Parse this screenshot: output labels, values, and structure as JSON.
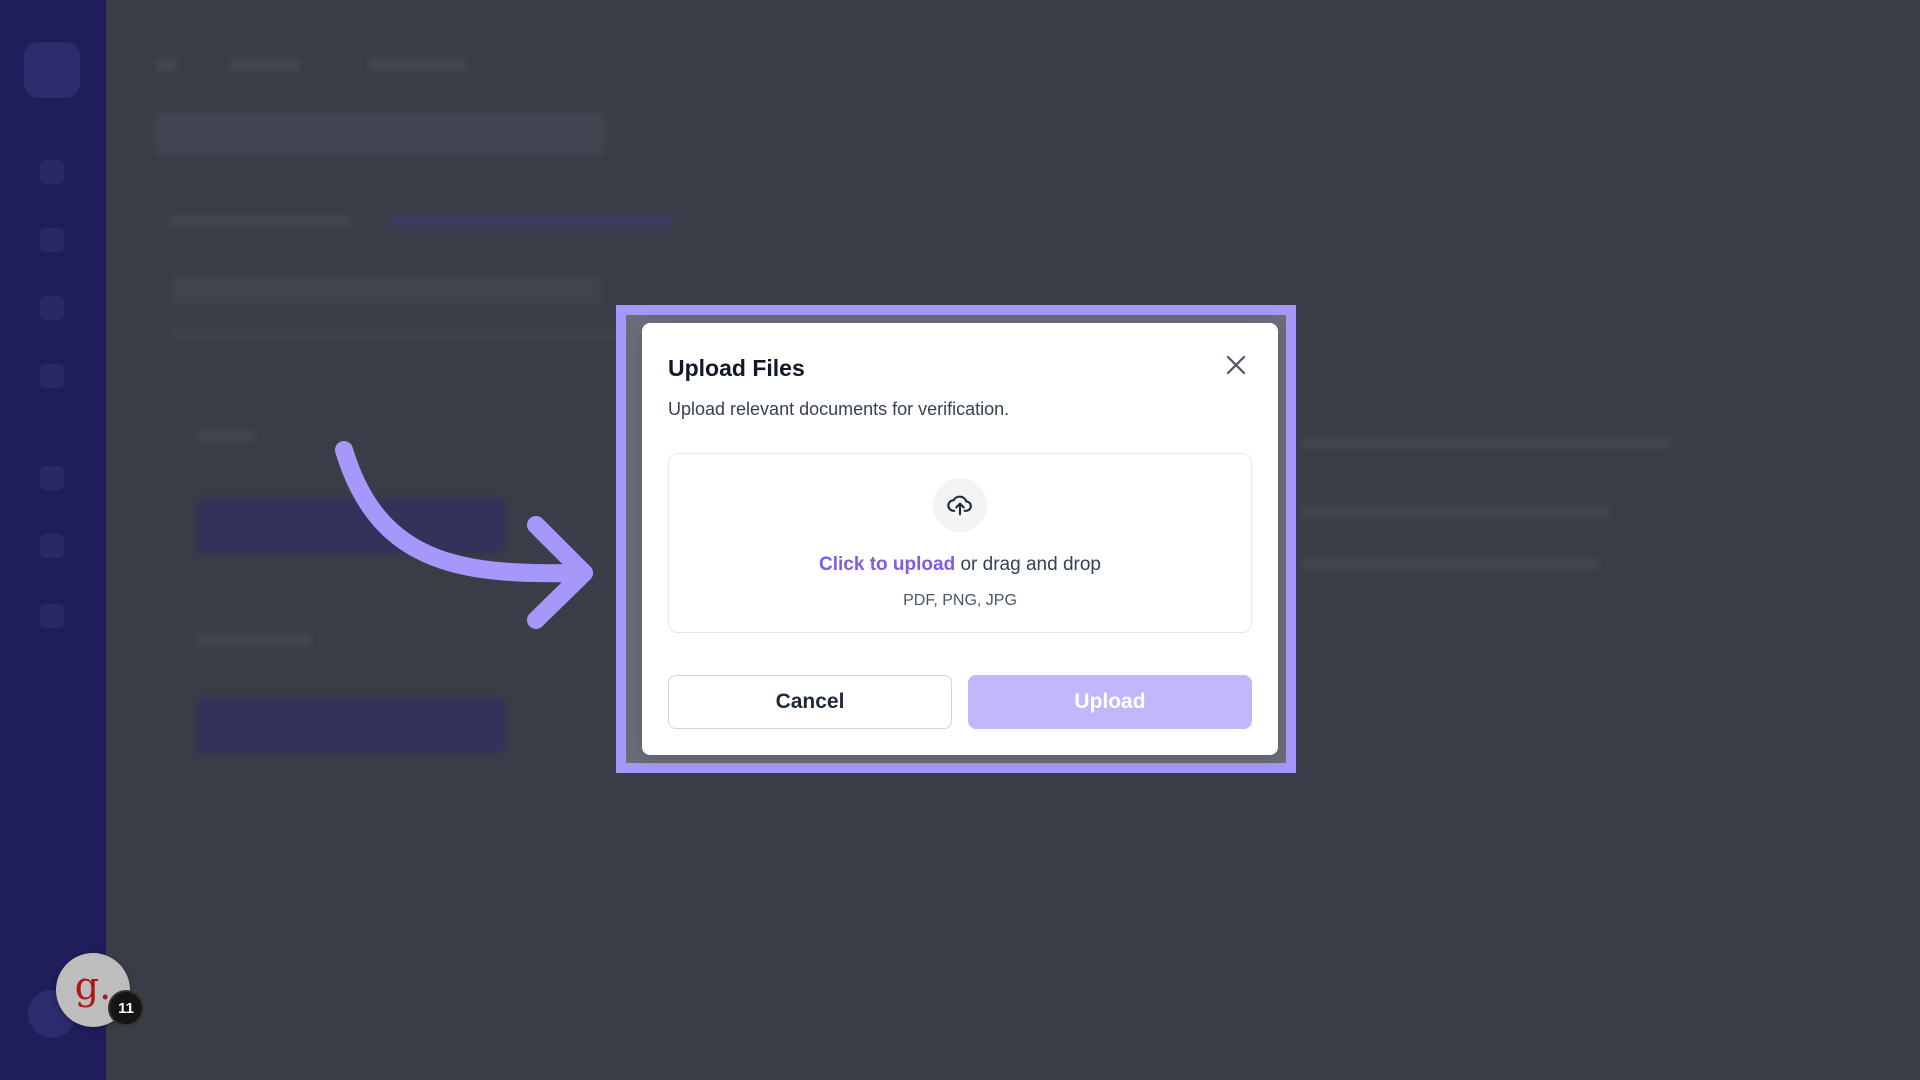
{
  "modal": {
    "title": "Upload Files",
    "subtitle": "Upload relevant documents for verification.",
    "close_icon": "close-icon",
    "dropzone": {
      "icon": "cloud-upload-icon",
      "link_text": "Click to upload",
      "rest_text": " or drag and drop",
      "file_types": "PDF, PNG, JPG"
    },
    "cancel_label": "Cancel",
    "upload_label": "Upload"
  },
  "badge": {
    "letter": "g.",
    "count": "11"
  },
  "colors": {
    "accent": "#7c5ce8",
    "highlight": "#a698fb",
    "upload_disabled": "#c4b6fb",
    "sidebar": "#1f1d5a",
    "overlay": "#3a3d47"
  }
}
